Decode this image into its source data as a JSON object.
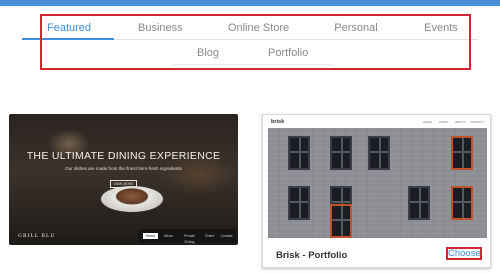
{
  "colors": {
    "accent": "#3d8fd6",
    "highlight": "#d0282e",
    "topbar": "#4a90d9"
  },
  "categories": {
    "row1": [
      "Featured",
      "Business",
      "Online Store",
      "Personal",
      "Events"
    ],
    "row2": [
      "Blog",
      "Portfolio"
    ],
    "active": "Featured"
  },
  "templates": [
    {
      "hero_headline": "THE ULTIMATE DINING EXPERIENCE",
      "hero_sub": "Our dishes are made from the finest farm-fresh ingredients",
      "hero_button": "VIEW MORE",
      "brand": "GRILL BLU",
      "menu": [
        "Home",
        "Menu",
        "Private Dining",
        "Chefs",
        "Contact"
      ]
    },
    {
      "brand": "brisk",
      "nav": [
        "HOME",
        "WORK",
        "ABOUT",
        "CONTACT"
      ],
      "title": "Brisk - Portfolio",
      "choose_label": "Choose"
    }
  ]
}
